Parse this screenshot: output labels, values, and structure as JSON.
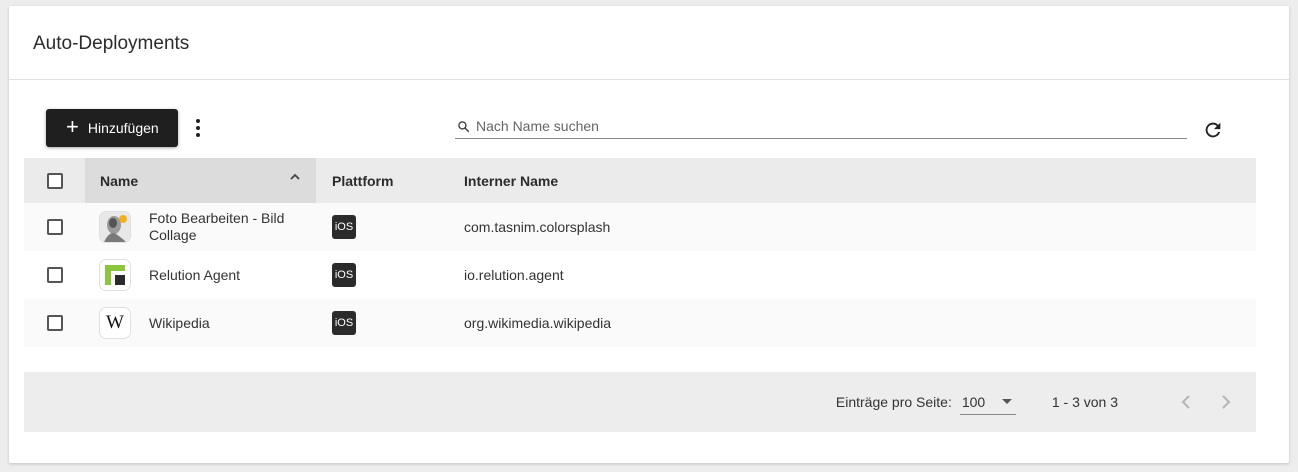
{
  "header": {
    "title": "Auto-Deployments"
  },
  "toolbar": {
    "add_label": "Hinzufügen",
    "search_placeholder": "Nach Name suchen",
    "more_icon": "more-vert-icon",
    "refresh_icon": "refresh-icon"
  },
  "table": {
    "columns": {
      "name": "Name",
      "platform": "Plattform",
      "internal": "Interner Name"
    },
    "sort": {
      "column": "name",
      "direction": "ascending"
    },
    "rows": [
      {
        "name": "Foto Bearbeiten - Bild Collage",
        "platform": "iOS",
        "internal": "com.tasnim.colorsplash",
        "icon": "colorsplash-app-icon"
      },
      {
        "name": "Relution Agent",
        "platform": "iOS",
        "internal": "io.relution.agent",
        "icon": "relution-app-icon"
      },
      {
        "name": "Wikipedia",
        "platform": "iOS",
        "internal": "org.wikimedia.wikipedia",
        "icon": "wikipedia-app-icon"
      }
    ]
  },
  "footer": {
    "per_page_label": "Einträge pro Seite:",
    "per_page_value": "100",
    "range": "1 - 3 von 3"
  },
  "colors": {
    "primary_button": "#1f1f1f",
    "relution_green": "#8cc63f",
    "header_bg": "#ebebeb"
  }
}
